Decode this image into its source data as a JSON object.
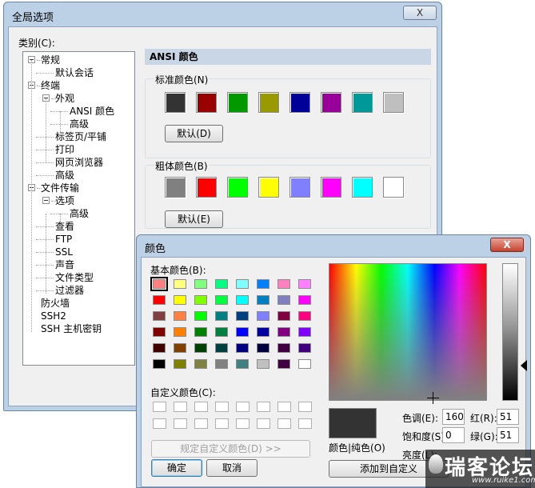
{
  "main_window": {
    "title": "全局选项",
    "close_label": "X",
    "category_label": "类别(C):",
    "tree": [
      {
        "label": "常规",
        "indent": 0,
        "expander": true
      },
      {
        "label": "默认会话",
        "indent": 1,
        "expander": false
      },
      {
        "label": "终端",
        "indent": 0,
        "expander": true
      },
      {
        "label": "外观",
        "indent": 1,
        "expander": true
      },
      {
        "label": "ANSI 颜色",
        "indent": 2,
        "expander": false
      },
      {
        "label": "高级",
        "indent": 2,
        "expander": false
      },
      {
        "label": "标签页/平铺",
        "indent": 1,
        "expander": false
      },
      {
        "label": "打印",
        "indent": 1,
        "expander": false
      },
      {
        "label": "网页浏览器",
        "indent": 1,
        "expander": false
      },
      {
        "label": "高级",
        "indent": 1,
        "expander": false
      },
      {
        "label": "文件传输",
        "indent": 0,
        "expander": true
      },
      {
        "label": "选项",
        "indent": 1,
        "expander": true
      },
      {
        "label": "高级",
        "indent": 2,
        "expander": false
      },
      {
        "label": "查看",
        "indent": 1,
        "expander": false
      },
      {
        "label": "FTP",
        "indent": 1,
        "expander": false
      },
      {
        "label": "SSL",
        "indent": 1,
        "expander": false
      },
      {
        "label": "声音",
        "indent": 1,
        "expander": false
      },
      {
        "label": "文件类型",
        "indent": 1,
        "expander": false
      },
      {
        "label": "过滤器",
        "indent": 1,
        "expander": false
      },
      {
        "label": "防火墙",
        "indent": 0,
        "expander": false
      },
      {
        "label": "SSH2",
        "indent": 0,
        "expander": false
      },
      {
        "label": "SSH 主机密钥",
        "indent": 0,
        "expander": false
      }
    ],
    "pane_title": "ANSI 颜色",
    "standard_group": {
      "label": "标准颜色(N)",
      "colors": [
        "#333333",
        "#990000",
        "#009900",
        "#999900",
        "#000099",
        "#990099",
        "#009999",
        "#bfbfbf"
      ],
      "default_button": "默认(D)"
    },
    "bold_group": {
      "label": "粗体颜色(B)",
      "colors": [
        "#808080",
        "#ff0000",
        "#00ff00",
        "#ffff00",
        "#8080ff",
        "#ff00ff",
        "#00ffff",
        "#ffffff"
      ],
      "default_button": "默认(E)"
    }
  },
  "color_dialog": {
    "title": "颜色",
    "close_label": "X",
    "basic_colors_label": "基本颜色(B):",
    "basic_colors": [
      [
        "#ff8080",
        "#ffff80",
        "#80ff80",
        "#00ff80",
        "#80ffff",
        "#0080ff",
        "#ff80c0",
        "#ff80ff"
      ],
      [
        "#ff0000",
        "#ffff00",
        "#80ff00",
        "#00ff40",
        "#00ffff",
        "#0080c0",
        "#8080c0",
        "#ff00ff"
      ],
      [
        "#804040",
        "#ff8040",
        "#00ff00",
        "#008080",
        "#004080",
        "#8080ff",
        "#800040",
        "#ff0080"
      ],
      [
        "#800000",
        "#ff8000",
        "#008000",
        "#008040",
        "#0000ff",
        "#0000a0",
        "#800080",
        "#8000ff"
      ],
      [
        "#400000",
        "#804000",
        "#004000",
        "#004040",
        "#000080",
        "#000040",
        "#400040",
        "#400080"
      ],
      [
        "#000000",
        "#808000",
        "#808040",
        "#808080",
        "#408080",
        "#c0c0c0",
        "#400040",
        "#ffffff"
      ]
    ],
    "custom_colors_label": "自定义颜色(C):",
    "define_custom_button": "规定自定义颜色(D) >>",
    "ok_button": "确定",
    "cancel_button": "取消",
    "color_solid_label": "颜色|纯色(O)",
    "hue_label": "色调(E):",
    "hue_value": "160",
    "sat_label": "饱和度(S):",
    "sat_value": "0",
    "lum_label": "亮度(L):",
    "red_label": "红(R):",
    "red_value": "51",
    "green_label": "绿(G):",
    "green_value": "51",
    "add_custom_button": "添加到自定义"
  },
  "watermark": {
    "text": "瑞客论坛",
    "url": "www.ruike1.com"
  }
}
